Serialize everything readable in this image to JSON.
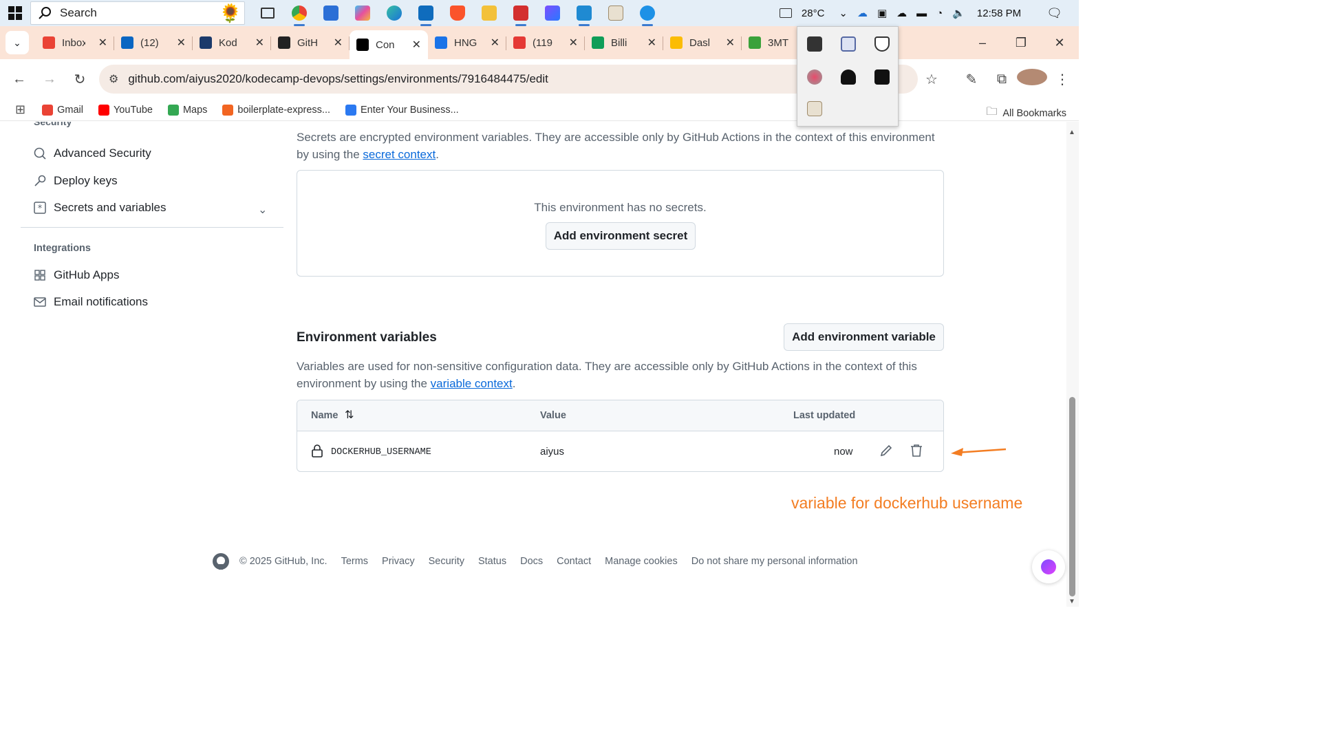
{
  "taskbar": {
    "search_placeholder": "Search",
    "weather": "28°C",
    "time": "12:58 PM"
  },
  "tabs": [
    {
      "title": "Inbox",
      "icon": "gmail-icon"
    },
    {
      "title": "(12)",
      "icon": "linkedin-icon"
    },
    {
      "title": "Kod",
      "icon": "kodecamp-icon"
    },
    {
      "title": "GitH",
      "icon": "openai-icon"
    },
    {
      "title": "Con",
      "icon": "github-icon",
      "active": true
    },
    {
      "title": "HNG",
      "icon": "hng-icon"
    },
    {
      "title": "(119",
      "icon": "notification-icon"
    },
    {
      "title": "Billi",
      "icon": "sheets-icon"
    },
    {
      "title": "Dasl",
      "icon": "dashboard-icon"
    },
    {
      "title": "3MT",
      "icon": "3mtt-icon"
    }
  ],
  "address_bar": {
    "url": "github.com/aiyus2020/kodecamp-devops/settings/environments/7916484475/edit"
  },
  "bookmarks": [
    {
      "label": "Gmail",
      "icon": "gmail-icon",
      "color": "#ea4335"
    },
    {
      "label": "YouTube",
      "icon": "youtube-icon",
      "color": "#ff0000"
    },
    {
      "label": "Maps",
      "icon": "maps-icon",
      "color": "#34a853"
    },
    {
      "label": "boilerplate-express...",
      "icon": "glitch-icon",
      "color": "#f26522"
    },
    {
      "label": "Enter Your Business...",
      "icon": "butterfly-icon",
      "color": "#2b79f1"
    }
  ],
  "all_bookmarks": "All Bookmarks",
  "sidebar": {
    "cut_header": "Security",
    "items": [
      {
        "label": "Advanced Security",
        "icon": "codescan-icon"
      },
      {
        "label": "Deploy keys",
        "icon": "key-icon"
      },
      {
        "label": "Secrets and variables",
        "icon": "asterisk-icon"
      }
    ],
    "integrations_header": "Integrations",
    "integrations": [
      {
        "label": "GitHub Apps",
        "icon": "apps-icon"
      },
      {
        "label": "Email notifications",
        "icon": "mail-icon"
      }
    ]
  },
  "secrets": {
    "description_pre": "Secrets are encrypted environment variables. They are accessible only by GitHub Actions in the context of this environment by using the ",
    "link": "secret context",
    "description_post": ".",
    "empty_text": "This environment has no secrets.",
    "add_button": "Add environment secret"
  },
  "variables": {
    "heading": "Environment variables",
    "add_button": "Add environment variable",
    "description_pre": "Variables are used for non-sensitive configuration data. They are accessible only by GitHub Actions in the context of this environment by using the ",
    "link": "variable context",
    "description_post": ".",
    "columns": {
      "name": "Name",
      "value": "Value",
      "updated": "Last updated"
    },
    "rows": [
      {
        "name": "DOCKERHUB_USERNAME",
        "value": "aiyus",
        "updated": "now"
      }
    ]
  },
  "annotation": "variable for dockerhub username",
  "footer": {
    "copyright": "© 2025 GitHub, Inc.",
    "links": [
      "Terms",
      "Privacy",
      "Security",
      "Status",
      "Docs",
      "Contact",
      "Manage cookies",
      "Do not share my personal information"
    ]
  },
  "colors": {
    "accent_link": "#0969da",
    "annotation": "#f37d22",
    "tabstrip": "#fbe4d7"
  }
}
